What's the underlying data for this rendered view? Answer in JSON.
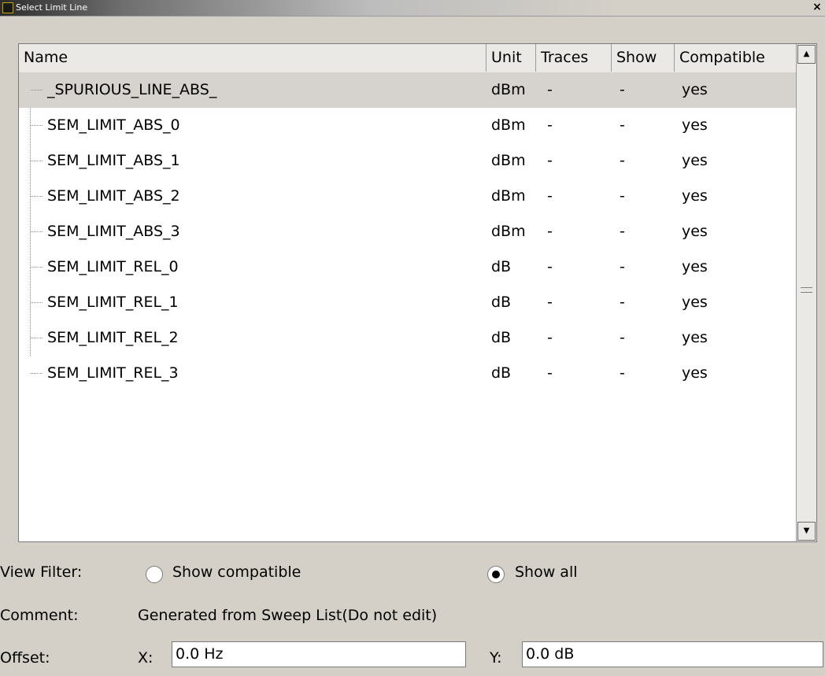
{
  "window": {
    "title": "Select Limit Line",
    "close_label": "×"
  },
  "table": {
    "columns": [
      "Name",
      "Unit",
      "Traces",
      "Show",
      "Compatible"
    ],
    "rows": [
      {
        "name": "_SPURIOUS_LINE_ABS_",
        "unit": "dBm",
        "traces": "-",
        "show": "-",
        "compatible": "yes"
      },
      {
        "name": "SEM_LIMIT_ABS_0",
        "unit": "dBm",
        "traces": "-",
        "show": "-",
        "compatible": "yes"
      },
      {
        "name": "SEM_LIMIT_ABS_1",
        "unit": "dBm",
        "traces": "-",
        "show": "-",
        "compatible": "yes"
      },
      {
        "name": "SEM_LIMIT_ABS_2",
        "unit": "dBm",
        "traces": "-",
        "show": "-",
        "compatible": "yes"
      },
      {
        "name": "SEM_LIMIT_ABS_3",
        "unit": "dBm",
        "traces": "-",
        "show": "-",
        "compatible": "yes"
      },
      {
        "name": "SEM_LIMIT_REL_0",
        "unit": "dB",
        "traces": "-",
        "show": "-",
        "compatible": "yes"
      },
      {
        "name": "SEM_LIMIT_REL_1",
        "unit": "dB",
        "traces": "-",
        "show": "-",
        "compatible": "yes"
      },
      {
        "name": "SEM_LIMIT_REL_2",
        "unit": "dB",
        "traces": "-",
        "show": "-",
        "compatible": "yes"
      },
      {
        "name": "SEM_LIMIT_REL_3",
        "unit": "dB",
        "traces": "-",
        "show": "-",
        "compatible": "yes"
      }
    ],
    "selected_row": "_SPURIOUS_LINE_ABS_"
  },
  "scrollbar": {
    "up_icon": "▲",
    "down_icon": "▼"
  },
  "view_filter": {
    "label": "View Filter:",
    "option_compatible": "Show compatible",
    "option_all": "Show all",
    "selected": "Show all"
  },
  "comment": {
    "label": "Comment:",
    "value": "Generated from Sweep List(Do not edit)"
  },
  "offset": {
    "label": "Offset:",
    "x_label": "X:",
    "x_value": "0.0 Hz",
    "y_label": "Y:",
    "y_value": "0.0 dB"
  },
  "colors": {
    "dialog_bg": "#d4d0c8",
    "selected_row_bg": "#d6d3ce",
    "table_bg": "#ffffff"
  }
}
